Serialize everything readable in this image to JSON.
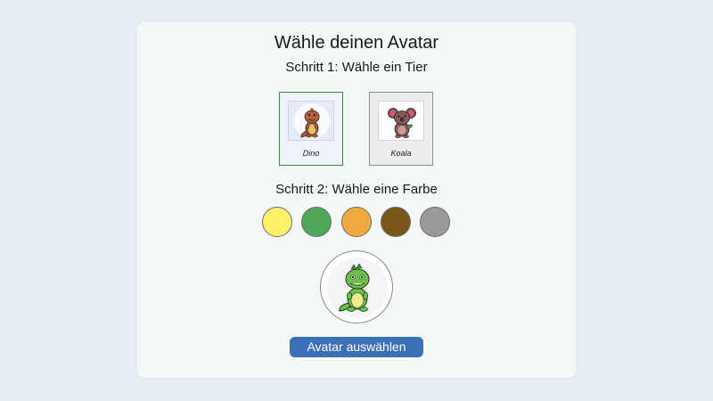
{
  "header": {
    "title": "Wähle deinen Avatar",
    "step1_label": "Schritt 1: Wähle ein Tier",
    "step2_label": "Schritt 2: Wähle eine Farbe"
  },
  "animals": [
    {
      "label": "Dino",
      "icon": "dino-icon",
      "selected": true
    },
    {
      "label": "Koala",
      "icon": "koala-icon",
      "selected": false
    }
  ],
  "colors": [
    {
      "name": "yellow",
      "hex": "#fff06a"
    },
    {
      "name": "green",
      "hex": "#4fa85a",
      "selected": true
    },
    {
      "name": "orange",
      "hex": "#f0a93c"
    },
    {
      "name": "brown",
      "hex": "#7a5618"
    },
    {
      "name": "gray",
      "hex": "#999999"
    }
  ],
  "preview": {
    "icon": "green-dino-icon"
  },
  "button": {
    "label": "Avatar auswählen"
  }
}
